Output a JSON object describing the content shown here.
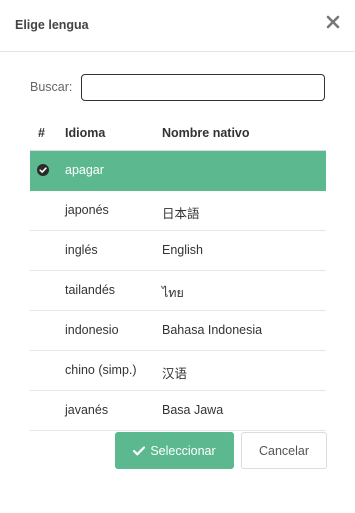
{
  "dialog": {
    "title": "Elige lengua",
    "close_icon": "close-icon"
  },
  "search": {
    "label": "Buscar:",
    "value": "",
    "placeholder": ""
  },
  "table": {
    "columns": {
      "num": "#",
      "language": "Idioma",
      "native": "Nombre nativo"
    },
    "rows": [
      {
        "language": "apagar",
        "native": "",
        "selected": true
      },
      {
        "language": "japonés",
        "native": "日本語",
        "selected": false
      },
      {
        "language": "inglés",
        "native": "English",
        "selected": false
      },
      {
        "language": "tailandés",
        "native": "ไทย",
        "selected": false
      },
      {
        "language": "indonesio",
        "native": "Bahasa Indonesia",
        "selected": false
      },
      {
        "language": "chino (simp.)",
        "native": "汉语",
        "selected": false
      },
      {
        "language": "javanés",
        "native": "Basa Jawa",
        "selected": false
      }
    ]
  },
  "buttons": {
    "select_label": "Seleccionar",
    "cancel_label": "Cancelar"
  },
  "colors": {
    "accent": "#5cb88e",
    "selected_text": "#ffffff"
  }
}
